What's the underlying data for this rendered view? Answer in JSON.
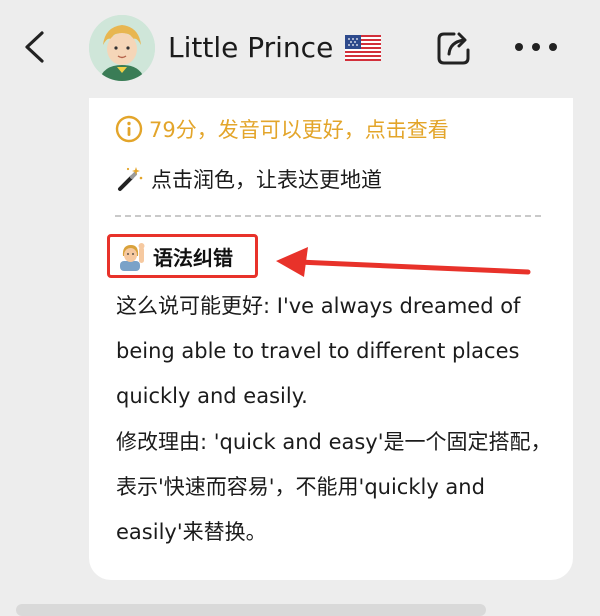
{
  "header": {
    "contact_name": "Little Prince",
    "flag_icon": "us-flag-icon",
    "back_icon": "chevron-left-icon",
    "share_icon": "share-icon",
    "more_icon": "more-dots-icon"
  },
  "message": {
    "score_text": "79分，发音可以更好，点击查看",
    "polish_text": "点击润色，让表达更地道",
    "correction": {
      "heading": "语法纠错",
      "suggestion": "这么说可能更好: I've always dreamed of being able to travel to different places quickly and easily.",
      "reason": "修改理由: 'quick and easy'是一个固定搭配，表示'快速而容易'，不能用'quickly and easily'来替换。"
    }
  },
  "colors": {
    "background": "#ededed",
    "card": "#ffffff",
    "score": "#e3a52a",
    "highlight": "#e8322a"
  }
}
